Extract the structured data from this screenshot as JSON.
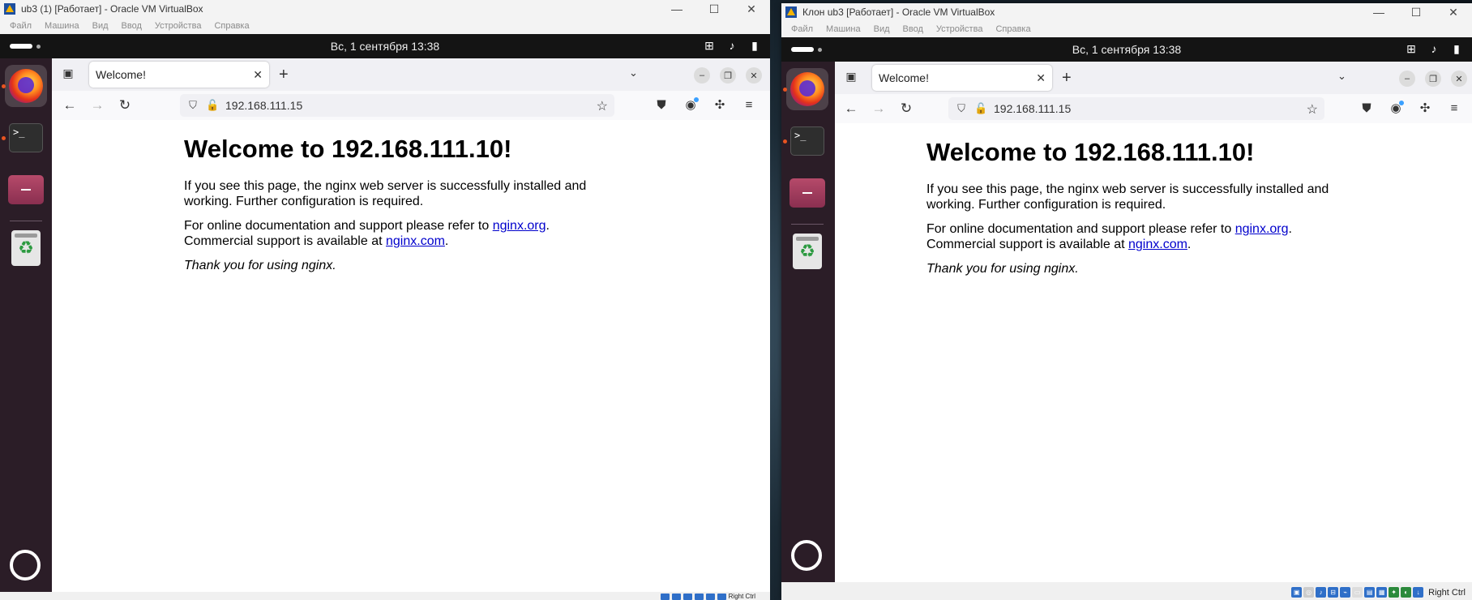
{
  "left_window": {
    "title": "ub3 (1) [Работает] - Oracle VM VirtualBox",
    "menu": [
      "Файл",
      "Машина",
      "Вид",
      "Ввод",
      "Устройства",
      "Справка"
    ],
    "clock": "Вс, 1 сентября  13:38",
    "tab_title": "Welcome!",
    "url": "192.168.111.15",
    "page": {
      "heading": "Welcome to 192.168.111.10!",
      "p1": "If you see this page, the nginx web server is successfully installed and working. Further configuration is required.",
      "p2_prefix": "For online documentation and support please refer to ",
      "link1": "nginx.org",
      "p2_mid": ".",
      "p2_line2": "Commercial support is available at ",
      "link2": "nginx.com",
      "p2_end": ".",
      "thanks": "Thank you for using nginx."
    },
    "host_key": "Right Ctrl"
  },
  "right_window": {
    "title": "Клон ub3 [Работает] - Oracle VM VirtualBox",
    "menu": [
      "Файл",
      "Машина",
      "Вид",
      "Ввод",
      "Устройства",
      "Справка"
    ],
    "clock": "Вс, 1 сентября  13:38",
    "tab_title": "Welcome!",
    "url": "192.168.111.15",
    "page": {
      "heading": "Welcome to 192.168.111.10!",
      "p1": "If you see this page, the nginx web server is successfully installed and working. Further configuration is required.",
      "p2_prefix": "For online documentation and support please refer to ",
      "link1": "nginx.org",
      "p2_mid": ".",
      "p2_line2": "Commercial support is available at ",
      "link2": "nginx.com",
      "p2_end": ".",
      "thanks": "Thank you for using nginx."
    },
    "host_key": "Right Ctrl"
  },
  "icons": {
    "minimize": "minimize-icon",
    "maximize": "maximize-icon",
    "close": "close-icon",
    "network": "network-icon",
    "volume": "volume-icon",
    "battery": "battery-icon"
  }
}
